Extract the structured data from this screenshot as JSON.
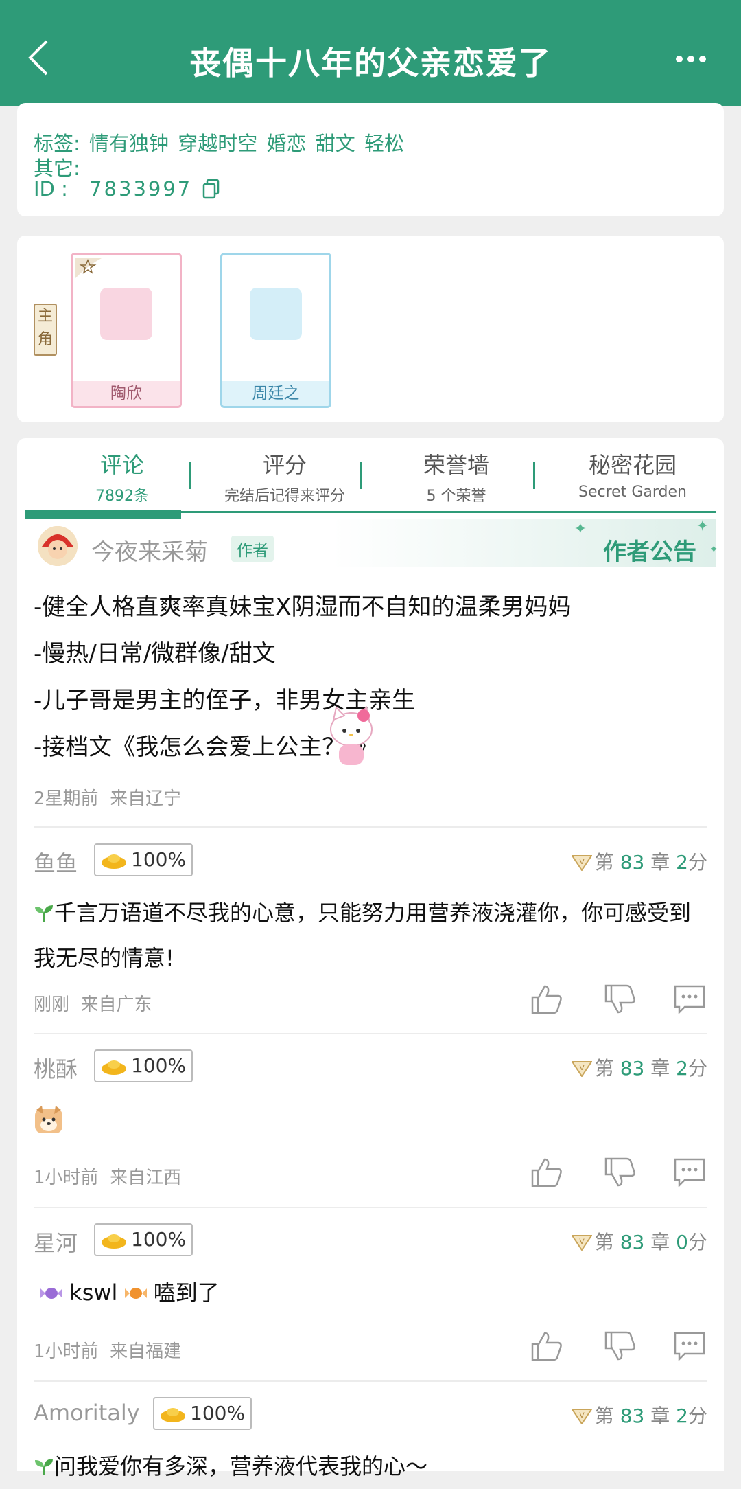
{
  "header": {
    "title": "丧偶十八年的父亲恋爱了"
  },
  "info": {
    "tags_label": "标签:",
    "tags": [
      "情有独钟",
      "穿越时空",
      "婚恋",
      "甜文",
      "轻松"
    ],
    "other_label": "其它:",
    "other_value": "",
    "id_label": "ID  :",
    "id_value": "7833997"
  },
  "roles": {
    "main_label_1": "主",
    "main_label_2": "角",
    "characters": [
      {
        "name": "陶欣"
      },
      {
        "name": "周廷之"
      }
    ]
  },
  "tabs": [
    {
      "label": "评论",
      "sub": "7892条"
    },
    {
      "label": "评分",
      "sub": "完结后记得来评分"
    },
    {
      "label": "荣誉墙",
      "sub": "5 个荣誉"
    },
    {
      "label": "秘密花园",
      "sub": "Secret Garden"
    }
  ],
  "notice": {
    "author": "今夜来采菊",
    "author_badge": "作者",
    "title": "作者公告",
    "lines": [
      "-健全人格直爽率真妹宝X阴湿而不自知的温柔男妈妈",
      "-慢热/日常/微群像/甜文",
      "-儿子哥是男主的侄子，非男女主亲生",
      "-接档文《我怎么会爱上公主？!》"
    ],
    "time": "2星期前",
    "location": "来自辽宁"
  },
  "comments": [
    {
      "name": "鱼鱼",
      "gold": "100%",
      "chapter_prefix": "第",
      "chapter": "83",
      "chapter_suffix": "章",
      "score": "2",
      "score_unit": "分",
      "text": "千言万语道不尽我的心意，只能努力用营养液浇灌你，你可感受到我无尽的情意!",
      "time": "刚刚",
      "location": "来自广东"
    },
    {
      "name": "桃酥",
      "gold": "100%",
      "chapter_prefix": "第",
      "chapter": "83",
      "chapter_suffix": "章",
      "score": "2",
      "score_unit": "分",
      "text": "",
      "time": "1小时前",
      "location": "来自江西"
    },
    {
      "name": "星河",
      "gold": "100%",
      "chapter_prefix": "第",
      "chapter": "83",
      "chapter_suffix": "章",
      "score": "0",
      "score_unit": "分",
      "text_a": "kswl",
      "text_b": "嗑到了",
      "time": "1小时前",
      "location": "来自福建"
    },
    {
      "name": "Amoritaly",
      "gold": "100%",
      "chapter_prefix": "第",
      "chapter": "83",
      "chapter_suffix": "章",
      "score": "2",
      "score_unit": "分",
      "text": "问我爱你有多深，营养液代表我的心～"
    }
  ],
  "colors": {
    "brand": "#2e9b78",
    "muted": "#999999"
  }
}
